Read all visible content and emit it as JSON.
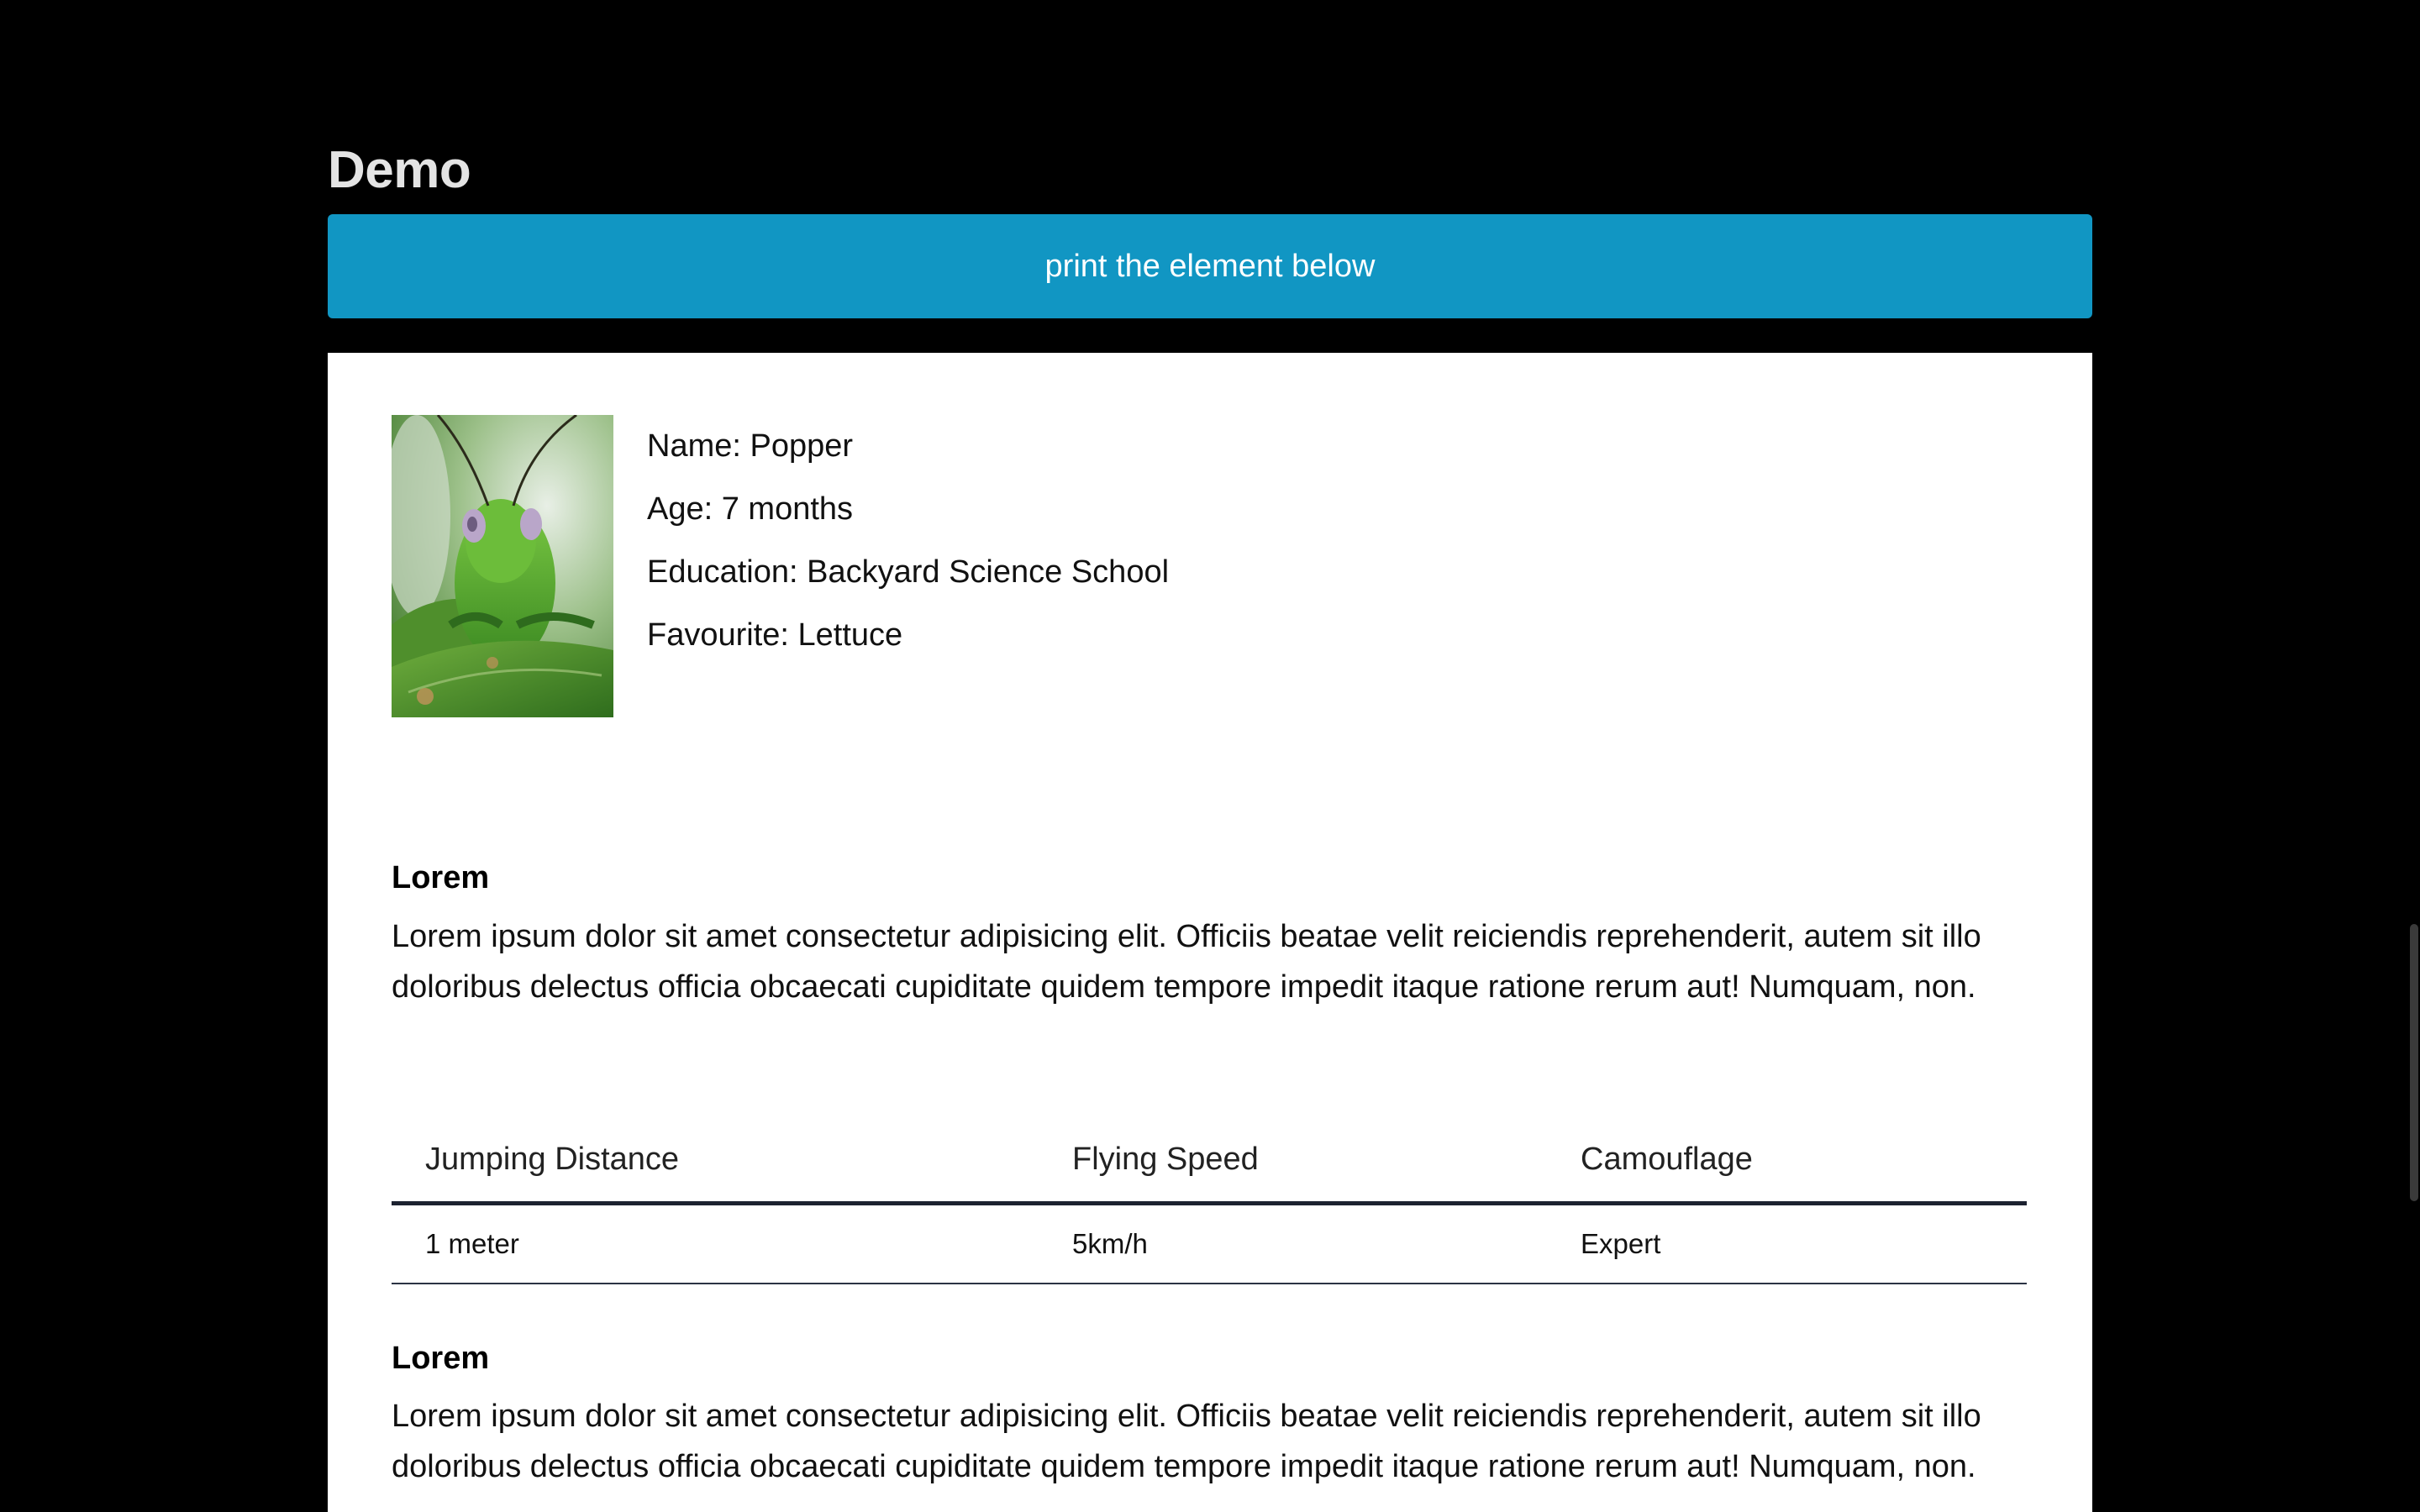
{
  "page": {
    "title": "Demo"
  },
  "print_button": {
    "label": "print the element below"
  },
  "profile": {
    "image_icon": "grasshopper-photo",
    "name_line": "Name: Popper",
    "age_line": "Age: 7 months",
    "education_line": "Education: Backyard Science School",
    "favourite_line": "Favourite: Lettuce"
  },
  "sections": [
    {
      "heading": "Lorem",
      "text": "Lorem ipsum dolor sit amet consectetur adipisicing elit. Officiis beatae velit reiciendis reprehenderit, autem sit illo doloribus delectus officia obcaecati cupiditate quidem tempore impedit itaque ratione rerum aut! Numquam, non."
    },
    {
      "heading": "Lorem",
      "text": "Lorem ipsum dolor sit amet consectetur adipisicing elit. Officiis beatae velit reiciendis reprehenderit, autem sit illo doloribus delectus officia obcaecati cupiditate quidem tempore impedit itaque ratione rerum aut! Numquam, non."
    }
  ],
  "stats_table": {
    "headers": [
      "Jumping Distance",
      "Flying Speed",
      "Camouflage"
    ],
    "rows": [
      [
        "1 meter",
        "5km/h",
        "Expert"
      ]
    ]
  },
  "colors": {
    "background": "#000000",
    "button": "#1196c3",
    "card": "#ffffff"
  }
}
